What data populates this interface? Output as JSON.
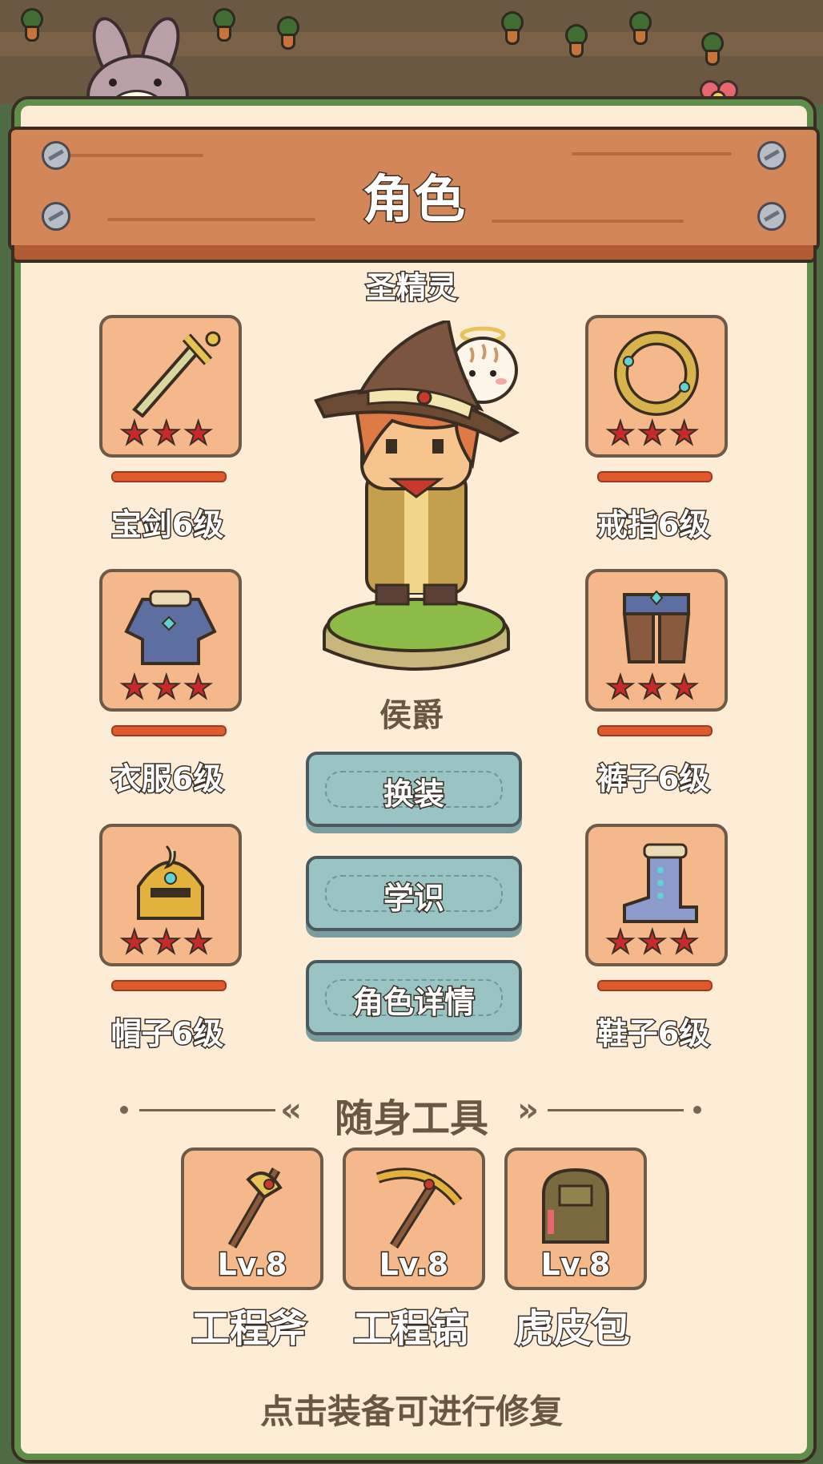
{
  "header": {
    "title": "角色"
  },
  "spirit": {
    "name": "圣精灵"
  },
  "character": {
    "rank": "侯爵"
  },
  "equipment": {
    "left": [
      {
        "label": "宝剑6级",
        "stars": 3,
        "icon": "sword-icon"
      },
      {
        "label": "衣服6级",
        "stars": 3,
        "icon": "armor-icon"
      },
      {
        "label": "帽子6级",
        "stars": 3,
        "icon": "helmet-icon"
      }
    ],
    "right": [
      {
        "label": "戒指6级",
        "stars": 3,
        "icon": "ring-icon"
      },
      {
        "label": "裤子6级",
        "stars": 3,
        "icon": "pants-icon"
      },
      {
        "label": "鞋子6级",
        "stars": 3,
        "icon": "boot-icon"
      }
    ]
  },
  "buttons": {
    "change_outfit": "换装",
    "knowledge": "学识",
    "details": "角色详情"
  },
  "tools_section": {
    "title": "随身工具",
    "items": [
      {
        "name": "工程斧",
        "level": "Lv.8",
        "icon": "axe-icon"
      },
      {
        "name": "工程镐",
        "level": "Lv.8",
        "icon": "pickaxe-icon"
      },
      {
        "name": "虎皮包",
        "level": "Lv.8",
        "icon": "backpack-icon"
      }
    ]
  },
  "hint": "点击装备可进行修复",
  "colors": {
    "panel": "#fdecd6",
    "header_wood": "#d38657",
    "slot": "#f5b88a",
    "button": "#9ac3c3",
    "star": "#c8292c",
    "durability_bar": "#e15a2e"
  }
}
